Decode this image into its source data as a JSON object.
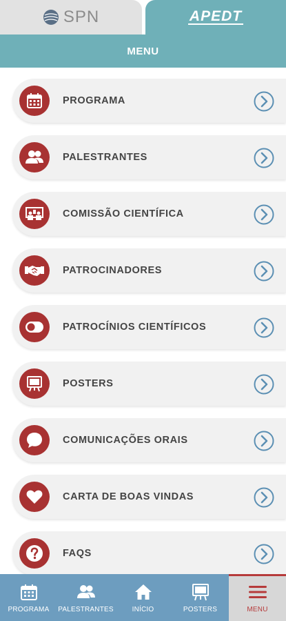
{
  "tabs": {
    "spn": "SPN",
    "apedt": "APEDT"
  },
  "header": {
    "title": "MENU"
  },
  "menu": {
    "items": [
      {
        "label": "PROGRAMA",
        "icon": "calendar-icon"
      },
      {
        "label": "PALESTRANTES",
        "icon": "people-icon"
      },
      {
        "label": "COMISSÃO CIENTÍFICA",
        "icon": "committee-icon"
      },
      {
        "label": "PATROCINADORES",
        "icon": "handshake-icon"
      },
      {
        "label": "PATROCÍNIOS CIENTÍFICOS",
        "icon": "toggle-icon"
      },
      {
        "label": "POSTERS",
        "icon": "easel-icon"
      },
      {
        "label": "COMUNICAÇÕES ORAIS",
        "icon": "speech-bubble-icon"
      },
      {
        "label": "CARTA DE BOAS VINDAS",
        "icon": "heart-icon"
      },
      {
        "label": "FAQS",
        "icon": "question-icon"
      }
    ]
  },
  "nav": {
    "items": [
      {
        "label": "PROGRAMA",
        "icon": "calendar-icon"
      },
      {
        "label": "PALESTRANTES",
        "icon": "people-icon"
      },
      {
        "label": "INÍCIO",
        "icon": "home-icon"
      },
      {
        "label": "POSTERS",
        "icon": "easel-icon"
      },
      {
        "label": "MENU",
        "icon": "hamburger-icon",
        "active": true
      }
    ]
  },
  "colors": {
    "teal": "#6fb0b8",
    "red": "#a83232",
    "nav_blue": "#6d9dbf",
    "chevron": "#5b8fb3"
  }
}
